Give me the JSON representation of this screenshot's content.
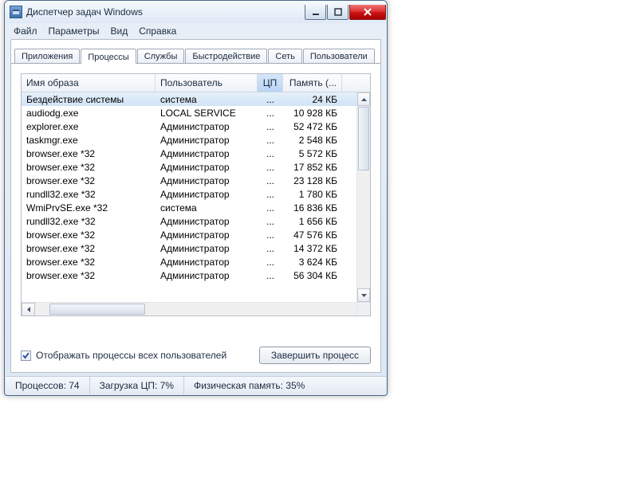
{
  "title": "Диспетчер задач Windows",
  "menu": [
    "Файл",
    "Параметры",
    "Вид",
    "Справка"
  ],
  "tabs": [
    "Приложения",
    "Процессы",
    "Службы",
    "Быстродействие",
    "Сеть",
    "Пользователи"
  ],
  "active_tab": 1,
  "columns": {
    "image": "Имя образа",
    "user": "Пользователь",
    "cpu": "ЦП",
    "memory": "Память (..."
  },
  "rows": [
    {
      "img": "Бездействие системы",
      "user": "система",
      "cpu": "...",
      "mem": "24 КБ",
      "selected": true
    },
    {
      "img": "audiodg.exe",
      "user": "LOCAL SERVICE",
      "cpu": "...",
      "mem": "10 928 КБ"
    },
    {
      "img": "explorer.exe",
      "user": "Администратор",
      "cpu": "...",
      "mem": "52 472 КБ"
    },
    {
      "img": "taskmgr.exe",
      "user": "Администратор",
      "cpu": "...",
      "mem": "2 548 КБ"
    },
    {
      "img": "browser.exe *32",
      "user": "Администратор",
      "cpu": "...",
      "mem": "5 572 КБ"
    },
    {
      "img": "browser.exe *32",
      "user": "Администратор",
      "cpu": "...",
      "mem": "17 852 КБ"
    },
    {
      "img": "browser.exe *32",
      "user": "Администратор",
      "cpu": "...",
      "mem": "23 128 КБ"
    },
    {
      "img": "rundll32.exe *32",
      "user": "Администратор",
      "cpu": "...",
      "mem": "1 780 КБ"
    },
    {
      "img": "WmiPrvSE.exe *32",
      "user": "система",
      "cpu": "...",
      "mem": "16 836 КБ"
    },
    {
      "img": "rundll32.exe *32",
      "user": "Администратор",
      "cpu": "...",
      "mem": "1 656 КБ"
    },
    {
      "img": "browser.exe *32",
      "user": "Администратор",
      "cpu": "...",
      "mem": "47 576 КБ"
    },
    {
      "img": "browser.exe *32",
      "user": "Администратор",
      "cpu": "...",
      "mem": "14 372 КБ"
    },
    {
      "img": "browser.exe *32",
      "user": "Администратор",
      "cpu": "...",
      "mem": "3 624 КБ"
    },
    {
      "img": "browser.exe *32",
      "user": "Администратор",
      "cpu": "...",
      "mem": "56 304 КБ"
    }
  ],
  "checkbox_label": "Отображать процессы всех пользователей",
  "checkbox_checked": true,
  "end_process_btn": "Завершить процесс",
  "status": {
    "processes": "Процессов: 74",
    "cpu": "Загрузка ЦП: 7%",
    "memory": "Физическая память: 35%"
  }
}
